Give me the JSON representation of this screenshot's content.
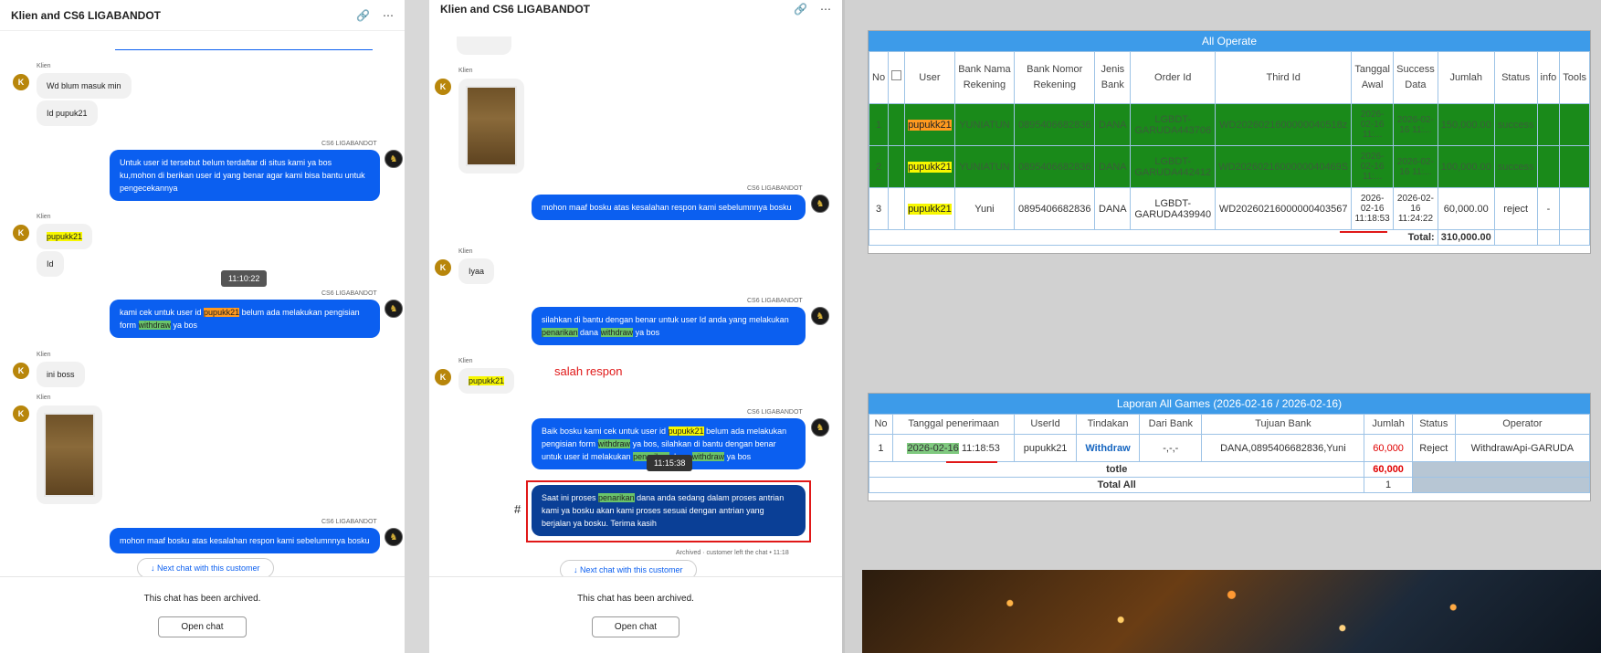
{
  "chat1": {
    "title": "Klien and CS6 LIGABANDOT",
    "klien": "Klien",
    "cs": "CS6 LIGABANDOT",
    "avatar_k": "K",
    "m1": "Wd blum masuk min",
    "m2": "Id pupuk21",
    "m3": "Untuk user id tersebut belum terdaftar di situs kami ya bos ku,mohon di berikan user id yang benar agar kami bisa bantu untuk pengecekannya",
    "m4": "pupukk21",
    "m5": "Id",
    "tooltip": "11:10:22",
    "m6a": "kami cek untuk user id ",
    "m6b": "pupukk21",
    "m6c": " belum ada melakukan pengisian form ",
    "m6d": "withdraw",
    "m6e": " ya bos",
    "m7": "ini boss",
    "m8": "mohon maaf bosku atas kesalahan respon kami sebelumnnya bosku",
    "next": "↓  Next chat with this customer",
    "archived": "This chat has been archived.",
    "open": "Open chat"
  },
  "chat2": {
    "title": "Klien and CS6 LIGABANDOT",
    "klien": "Klien",
    "cs": "CS6 LIGABANDOT",
    "avatar_k": "K",
    "m1": "mohon maaf bosku atas kesalahan respon kami sebelumnnya bosku",
    "m2": "Iyaa",
    "m3a": "silahkan di bantu dengan benar untuk user Id anda yang melakukan ",
    "m3b": "penarikan",
    "m3c": " dana ",
    "m3d": "withdraw",
    "m3e": " ya bos",
    "m4": "pupukk21",
    "annotation": "salah respon",
    "m5a": "Baik bosku kami cek untuk user id ",
    "m5b": "pupukk21",
    "m5c": " belum ada melakukan pengisian form ",
    "m5d": "withdraw",
    "m5e": " ya bos, silahkan di bantu dengan benar untuk user id ",
    "m5f": " melakukan ",
    "m5g": "penarikan",
    "m5h": " dana ",
    "m5i": "withdraw",
    "m5j": " ya bos",
    "tooltip": "11:15:38",
    "m6a": "Saat ini proses ",
    "m6b": "penarikan",
    "m6c": " dana anda sedang dalam proses antrian kami ya bosku akan kami proses sesuai dengan antrian yang berjalan ya bosku. Terima kasih",
    "hash": "#",
    "status": "Archived · customer left the chat • 11:18",
    "next": "↓  Next chat with this customer",
    "archived": "This chat has been archived.",
    "open": "Open chat"
  },
  "all_operate": {
    "title": "All Operate",
    "headers": [
      "No",
      "",
      "User",
      "Bank Nama Rekening",
      "Bank Nomor Rekening",
      "Jenis Bank",
      "Order Id",
      "Third Id",
      "Tanggal Awal",
      "Success Data",
      "Jumlah",
      "Status",
      "info",
      "Tools"
    ],
    "rows": [
      [
        "1",
        "",
        "pupukk21",
        "YUNIATUN",
        "0895406682836",
        "DANA",
        "LGBDT-GARUDA443706",
        "WD2026021600000040518z",
        "2026-02-16 11:...",
        "2026-02-16 11:...",
        "150,000.00",
        "success",
        "",
        ""
      ],
      [
        "2",
        "",
        "pupukk21",
        "YUNIATUN",
        "0895406682836",
        "DANA",
        "LGBDT-GARUDA442412",
        "WD2026021600000040469S",
        "2026-02-16 11:...",
        "2026-02-16 11:...",
        "100,000.00",
        "success",
        "",
        ""
      ],
      [
        "3",
        "",
        "pupukk21",
        "Yuni",
        "0895406682836",
        "DANA",
        "LGBDT-GARUDA439940",
        "WD20260216000000403567",
        "2026-02-16 11:18:53",
        "2026-02-16 11:24:22",
        "60,000.00",
        "reject",
        "-",
        ""
      ]
    ],
    "total_label": "Total:",
    "total_value": "310,000.00"
  },
  "laporan": {
    "title": "Laporan All Games (2026-02-16 / 2026-02-16)",
    "headers": [
      "No",
      "Tanggal penerimaan",
      "UserId",
      "Tindakan",
      "Dari Bank",
      "Tujuan Bank",
      "Jumlah",
      "Status",
      "Operator"
    ],
    "row": [
      "1",
      "2026-02-16",
      "11:18:53",
      "pupukk21",
      "Withdraw",
      "-,-,-",
      "DANA,0895406682836,Yuni",
      "60,000",
      "Reject",
      "WithdrawApi-GARUDA"
    ],
    "totle_label": "totle",
    "totle_value": "60,000",
    "total_all_label": "Total All",
    "total_all_value": "1"
  },
  "colors": {
    "accent": "#0b5ff0",
    "table_header": "#3d9be9",
    "success_row": "#1a8a1a",
    "highlight": "#f7f700"
  }
}
